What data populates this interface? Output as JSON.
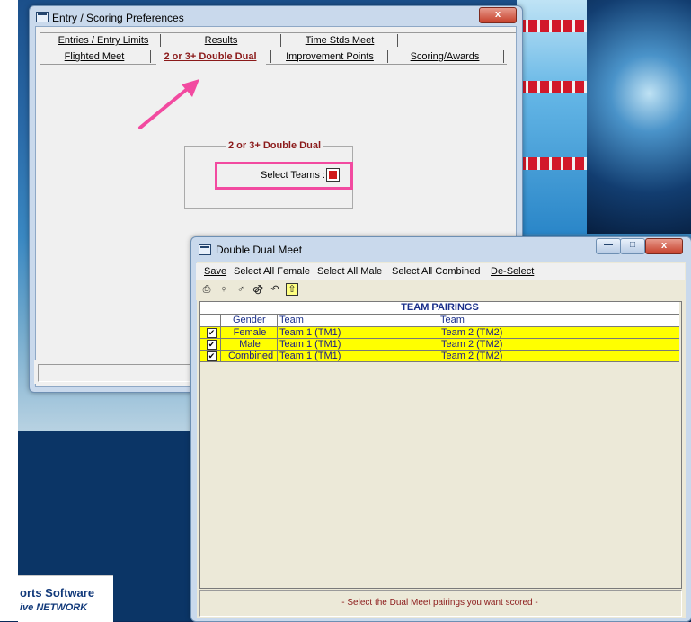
{
  "background": {
    "brand_line1": "orts Software",
    "brand_line2": "ive NETWORK"
  },
  "prefs_window": {
    "title": "Entry / Scoring Preferences",
    "close_label": "x",
    "tabs_row1": [
      "Entries / Entry Limits",
      "Results",
      "Time Stds Meet"
    ],
    "tabs_row2": [
      "Flighted Meet",
      "2 or 3+ Double Dual",
      "Improvement Points",
      "Scoring/Awards"
    ],
    "active_tab": "2 or 3+ Double Dual",
    "group_title": "2 or 3+ Double Dual",
    "select_teams_label": "Select Teams :"
  },
  "dual_window": {
    "title": "Double Dual Meet",
    "menu": [
      "Save",
      "Select All Female",
      "Select All Male",
      "Select All Combined",
      "De-Select"
    ],
    "toolbar_icons": [
      "printer-icon",
      "female-select-icon",
      "male-select-icon",
      "combined-select-icon",
      "undo-icon",
      "export-icon"
    ],
    "grid": {
      "caption": "TEAM PAIRINGS",
      "columns": [
        "Gender",
        "Team",
        "Team"
      ],
      "rows": [
        {
          "checked": true,
          "gender": "Female",
          "team1": "Team 1 (TM1)",
          "team2": "Team 2 (TM2)"
        },
        {
          "checked": true,
          "gender": "Male",
          "team1": "Team 1 (TM1)",
          "team2": "Team 2 (TM2)"
        },
        {
          "checked": true,
          "gender": "Combined",
          "team1": "Team 1 (TM1)",
          "team2": "Team 2 (TM2)"
        }
      ]
    },
    "status": "- Select the Dual Meet pairings you want scored -"
  },
  "colors": {
    "highlight_pink": "#f24aa0",
    "row_yellow": "#ffff00",
    "accent_red": "#8b1a1a"
  }
}
